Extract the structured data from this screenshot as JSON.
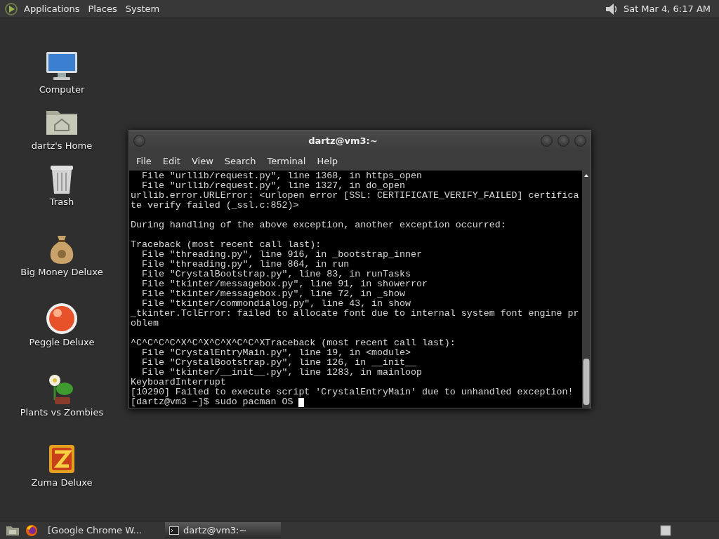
{
  "top_panel": {
    "menus": [
      "Applications",
      "Places",
      "System"
    ],
    "clock": "Sat Mar 4, 6:17 AM"
  },
  "desktop_icons": [
    {
      "label": "Computer",
      "kind": "computer"
    },
    {
      "label": "dartz's Home",
      "kind": "home"
    },
    {
      "label": "Trash",
      "kind": "trash"
    },
    {
      "label": "Big Money Deluxe",
      "kind": "money"
    },
    {
      "label": "Peggle Deluxe",
      "kind": "peggle"
    },
    {
      "label": "Plants vs Zombies",
      "kind": "plants"
    },
    {
      "label": "Zuma Deluxe",
      "kind": "zuma"
    }
  ],
  "terminal": {
    "title": "dartz@vm3:~",
    "menu": [
      "File",
      "Edit",
      "View",
      "Search",
      "Terminal",
      "Help"
    ],
    "blocks": [
      [
        "  File \"urllib/request.py\", line 1368, in https_open",
        "  File \"urllib/request.py\", line 1327, in do_open",
        "urllib.error.URLError: <urlopen error [SSL: CERTIFICATE_VERIFY_FAILED] certifica",
        "te verify failed (_ssl.c:852)>"
      ],
      [
        "During handling of the above exception, another exception occurred:"
      ],
      [
        "Traceback (most recent call last):",
        "  File \"threading.py\", line 916, in _bootstrap_inner",
        "  File \"threading.py\", line 864, in run",
        "  File \"CrystalBootstrap.py\", line 83, in runTasks",
        "  File \"tkinter/messagebox.py\", line 91, in showerror",
        "  File \"tkinter/messagebox.py\", line 72, in _show",
        "  File \"tkinter/commondialog.py\", line 43, in show",
        "_tkinter.TclError: failed to allocate font due to internal system font engine pr",
        "oblem"
      ],
      [
        "^C^C^C^C^X^C^X^C^X^C^C^XTraceback (most recent call last):",
        "  File \"CrystalEntryMain.py\", line 19, in <module>",
        "  File \"CrystalBootstrap.py\", line 126, in __init__",
        "  File \"tkinter/__init__.py\", line 1283, in mainloop",
        "KeyboardInterrupt",
        "[10290] Failed to execute script 'CrystalEntryMain' due to unhandled exception!"
      ]
    ],
    "prompt": "[dartz@vm3 ~]$ sudo pacman OS "
  },
  "taskbar": {
    "tasks": [
      {
        "label": "[Google Chrome W...",
        "kind": "browser",
        "selected": false
      },
      {
        "label": "dartz@vm3:~",
        "kind": "terminal",
        "selected": true
      }
    ]
  }
}
